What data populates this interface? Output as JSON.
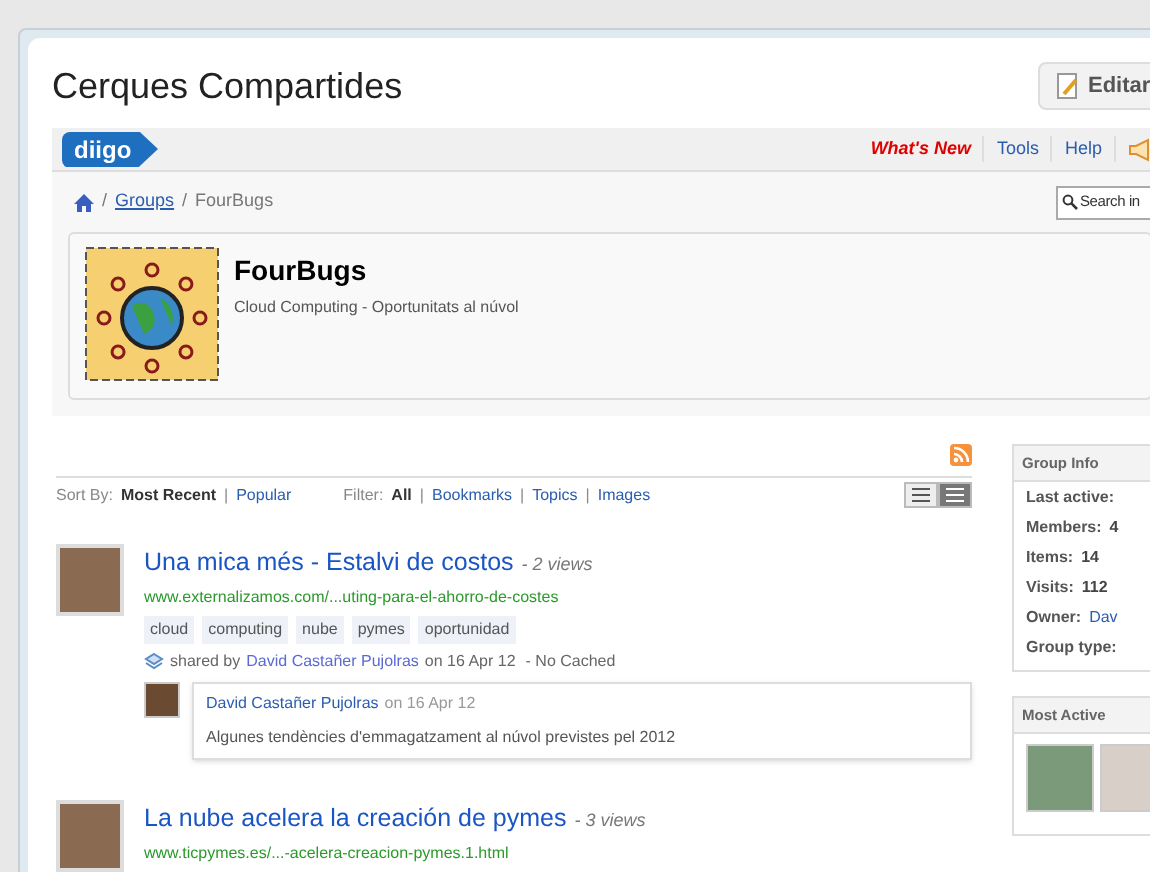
{
  "window": {
    "title": "Cerques Compartides",
    "edit_button": "Editar"
  },
  "topbar": {
    "logo": "diigo",
    "links": [
      {
        "label": "What's New",
        "kind": "highlight"
      },
      {
        "label": "Tools",
        "kind": "link"
      },
      {
        "label": "Help",
        "kind": "link"
      }
    ]
  },
  "breadcrumb": {
    "separator": "/",
    "items": [
      "Groups"
    ],
    "current": "FourBugs"
  },
  "separator": "|",
  "search": {
    "placeholder": "Search in"
  },
  "group": {
    "name": "FourBugs",
    "description": "Cloud Computing - Oportunitats al núvol"
  },
  "sort": {
    "label": "Sort By:",
    "options": [
      {
        "label": "Most Recent",
        "selected": true
      },
      {
        "label": "Popular",
        "selected": false
      }
    ]
  },
  "filter": {
    "label": "Filter:",
    "options": [
      {
        "label": "All",
        "selected": true
      },
      {
        "label": "Bookmarks",
        "selected": false
      },
      {
        "label": "Topics",
        "selected": false
      },
      {
        "label": "Images",
        "selected": false
      }
    ]
  },
  "view_toggle": [
    {
      "selected": false
    },
    {
      "selected": true
    }
  ],
  "items": [
    {
      "title": "Una mica més - Estalvi de costos",
      "views": "- 2 views",
      "url": "www.externalizamos.com/...uting-para-el-ahorro-de-costes",
      "tags": [
        "cloud",
        "computing",
        "nube",
        "pymes",
        "oportunidad"
      ],
      "shared_prefix": "shared by",
      "shared_by": "David Castañer Pujolras",
      "date": "on 16 Apr 12",
      "cached": "- No Cached",
      "comment": {
        "author": "David Castañer Pujolras",
        "date": "on 16 Apr 12",
        "text": "Algunes tendències d'emmagatzament al núvol previstes pel 2012"
      }
    },
    {
      "title": "La nube acelera la creación de pymes",
      "views": "- 3 views",
      "url": "www.ticpymes.es/...-acelera-creacion-pymes.1.html"
    }
  ],
  "group_info": {
    "title": "Group Info",
    "rows": [
      {
        "label": "Last active:"
      },
      {
        "label": "Members:",
        "value": "4"
      },
      {
        "label": "Items:",
        "value": "14"
      },
      {
        "label": "Visits:",
        "value": "112"
      },
      {
        "label": "Owner:",
        "value": "Dav",
        "link": true
      },
      {
        "label": "Group type:"
      }
    ]
  },
  "most_active": {
    "title": "Most Active"
  }
}
